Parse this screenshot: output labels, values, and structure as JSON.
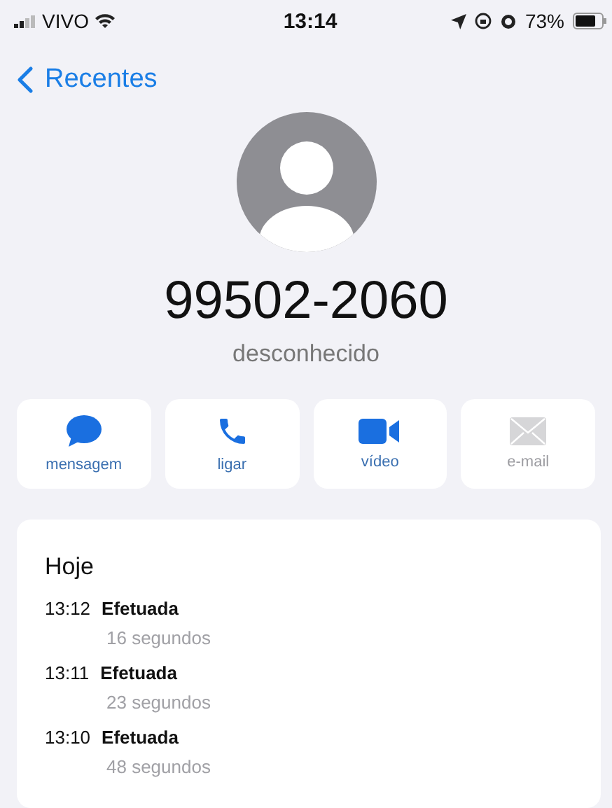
{
  "status_bar": {
    "carrier": "VIVO",
    "time": "13:14",
    "battery": "73%"
  },
  "nav": {
    "back_label": "Recentes"
  },
  "contact": {
    "number": "99502-2060",
    "label": "desconhecido"
  },
  "actions": [
    {
      "kind": "message",
      "label": "mensagem",
      "disabled": false
    },
    {
      "kind": "call",
      "label": "ligar",
      "disabled": false
    },
    {
      "kind": "video",
      "label": "vídeo",
      "disabled": false
    },
    {
      "kind": "mail",
      "label": "e-mail",
      "disabled": true
    }
  ],
  "history": {
    "heading": "Hoje",
    "calls": [
      {
        "time": "13:12",
        "type": "Efetuada",
        "duration": "16 segundos"
      },
      {
        "time": "13:11",
        "type": "Efetuada",
        "duration": "23 segundos"
      },
      {
        "time": "13:10",
        "type": "Efetuada",
        "duration": "48 segundos"
      }
    ]
  }
}
